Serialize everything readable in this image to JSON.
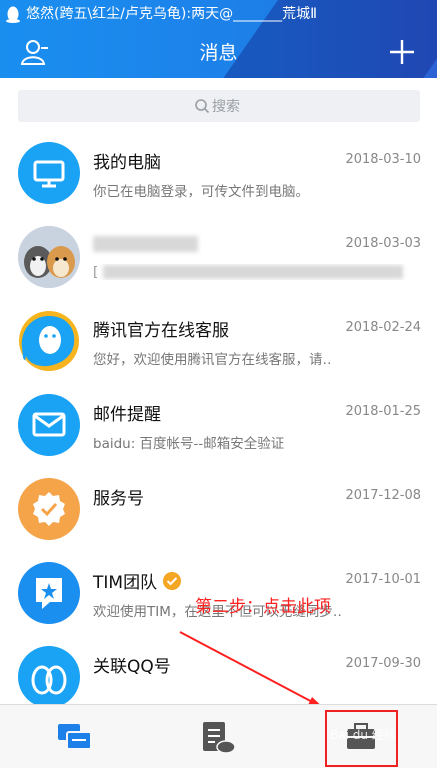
{
  "status_bar": {
    "text": "悠然(跨五\\红尘/卢克乌龟):两天@_______荒城Ⅱ"
  },
  "header": {
    "title": "消息"
  },
  "search": {
    "placeholder": "搜索"
  },
  "conversations": [
    {
      "name": "我的电脑",
      "date": "2018-03-10",
      "preview": "你已在电脑登录，可传文件到电脑。",
      "avatar_icon": "monitor-icon",
      "avatar_color": "#1aa3f5"
    },
    {
      "name": "",
      "date": "2018-03-03",
      "preview": "[",
      "avatar_icon": "dogs-photo",
      "avatar_color": "#cfd6e0"
    },
    {
      "name": "腾讯官方在线客服",
      "date": "2018-02-24",
      "preview": "您好，欢迎使用腾讯官方在线客服，请‥",
      "avatar_icon": "qq-penguin-icon",
      "avatar_color": "#1aa3f5"
    },
    {
      "name": "邮件提醒",
      "date": "2018-01-25",
      "preview": "baidu: 百度帐号--邮箱安全验证",
      "avatar_icon": "mail-icon",
      "avatar_color": "#1aa3f5"
    },
    {
      "name": "服务号",
      "date": "2017-12-08",
      "preview": "",
      "avatar_icon": "check-badge-icon",
      "avatar_color": "#f5a44a"
    },
    {
      "name": "TIM团队",
      "date": "2017-10-01",
      "preview": "欢迎使用TIM，在这里不但可以无缝同步‥",
      "avatar_icon": "star-chat-icon",
      "avatar_color": "#1a8ff0"
    },
    {
      "name": "关联QQ号",
      "date": "2017-09-30",
      "preview": "",
      "avatar_icon": "linked-accounts-icon",
      "avatar_color": "#1aa3f5"
    }
  ],
  "annotation": {
    "text": "第二步：点击此项",
    "color": "#ff2020"
  },
  "tabs": [
    {
      "name": "messages",
      "icon": "chat-icon",
      "active": true
    },
    {
      "name": "docs",
      "icon": "document-cloud-icon",
      "active": false
    },
    {
      "name": "workbench",
      "icon": "briefcase-icon",
      "active": false
    }
  ],
  "watermark": {
    "text": "Bai du 经验"
  },
  "colors": {
    "accent": "#1a8ff0",
    "annotation_red": "#e22222"
  }
}
